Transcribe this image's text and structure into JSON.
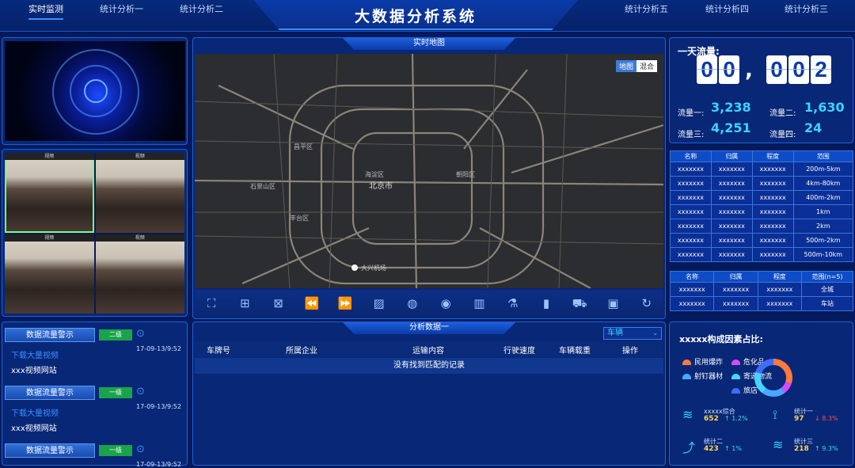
{
  "nav": {
    "left": [
      "实时监测",
      "统计分析一",
      "统计分析二"
    ],
    "right": [
      "统计分析五",
      "统计分析四",
      "统计分析三"
    ],
    "title": "大数据分析系统"
  },
  "map": {
    "tab": "实时地图",
    "toggle": [
      "地图",
      "混合"
    ],
    "labels": [
      "北京市",
      "昌平区",
      "海淀区",
      "石景山区",
      "丰台区",
      "朝阳区",
      "大兴机场"
    ],
    "tools": [
      "fullscreen-icon",
      "zoom-in-icon",
      "zoom-out-icon",
      "rewind-icon",
      "forward-icon",
      "layers-icon",
      "globe-icon",
      "camera-icon",
      "buildings-icon",
      "flask-icon",
      "chart-icon",
      "truck-icon",
      "screen-icon",
      "refresh-icon"
    ]
  },
  "cams": {
    "label": "视频"
  },
  "flow": {
    "label": "一天流量:",
    "digits": [
      "0",
      "0",
      ",",
      "0",
      "0",
      "2"
    ],
    "items": [
      {
        "k": "流量一:",
        "v": "3,238"
      },
      {
        "k": "流量二:",
        "v": "1,630"
      },
      {
        "k": "流量三:",
        "v": "4,251"
      },
      {
        "k": "流量四:",
        "v": "24"
      }
    ]
  },
  "table1": {
    "headers": [
      "名称",
      "归属",
      "程度",
      "范围"
    ],
    "rows": [
      [
        "xxxxxxx",
        "xxxxxxx",
        "xxxxxxx",
        "200m-5km"
      ],
      [
        "xxxxxxx",
        "xxxxxxx",
        "xxxxxxx",
        "4km-80km"
      ],
      [
        "xxxxxxx",
        "xxxxxxx",
        "xxxxxxx",
        "400m-2km"
      ],
      [
        "xxxxxxx",
        "xxxxxxx",
        "xxxxxxx",
        "1km"
      ],
      [
        "xxxxxxx",
        "xxxxxxx",
        "xxxxxxx",
        "2km"
      ],
      [
        "xxxxxxx",
        "xxxxxxx",
        "xxxxxxx",
        "500m-2km"
      ],
      [
        "xxxxxxx",
        "xxxxxxx",
        "xxxxxxx",
        "500m-10km"
      ]
    ]
  },
  "table2": {
    "headers": [
      "名称",
      "归属",
      "程度",
      "范围(n=5)"
    ],
    "rows": [
      [
        "xxxxxxx",
        "xxxxxxx",
        "xxxxxxx",
        "全城"
      ],
      [
        "xxxxxxx",
        "xxxxxxx",
        "xxxxxxx",
        "车站"
      ]
    ]
  },
  "alerts": [
    {
      "btn": "数据流量警示",
      "level": "二级",
      "time": "17-09-13/9:52",
      "t1": "下载大量视频",
      "t2": "xxx视频网站"
    },
    {
      "btn": "数据流量警示",
      "level": "一级",
      "time": "17-09-13/9:52",
      "t1": "下载大量视频",
      "t2": "xxx视频网站"
    },
    {
      "btn": "数据流量警示",
      "level": "一级",
      "time": "17-09-13/9:52",
      "t1": "",
      "t2": ""
    }
  ],
  "analysis": {
    "tab": "分析数据一",
    "select": "车辆",
    "headers": [
      "车牌号",
      "所属企业",
      "运输内容",
      "行驶速度",
      "车辆载重",
      "操作"
    ],
    "empty": "没有找到匹配的记录"
  },
  "factors": {
    "title": "xxxxx构成因素占比:",
    "legend": [
      {
        "name": "民用爆炸",
        "color": "#ff7a3c"
      },
      {
        "name": "危化品",
        "color": "#d24cff"
      },
      {
        "name": "射钉器材",
        "color": "#4aa8ff"
      },
      {
        "name": "寄递物流",
        "color": "#47d4ff"
      },
      {
        "name": "旅店",
        "color": "#3c6dff"
      }
    ],
    "stats": [
      {
        "name": "xxxxx综合",
        "val": "652",
        "chg": "1.2%",
        "dir": "up"
      },
      {
        "name": "统计一",
        "val": "97",
        "chg": "8.3%",
        "dir": "down"
      },
      {
        "name": "统计二",
        "val": "423",
        "chg": "1%",
        "dir": "up"
      },
      {
        "name": "统计三",
        "val": "218",
        "chg": "9.3%",
        "dir": "up"
      }
    ]
  }
}
